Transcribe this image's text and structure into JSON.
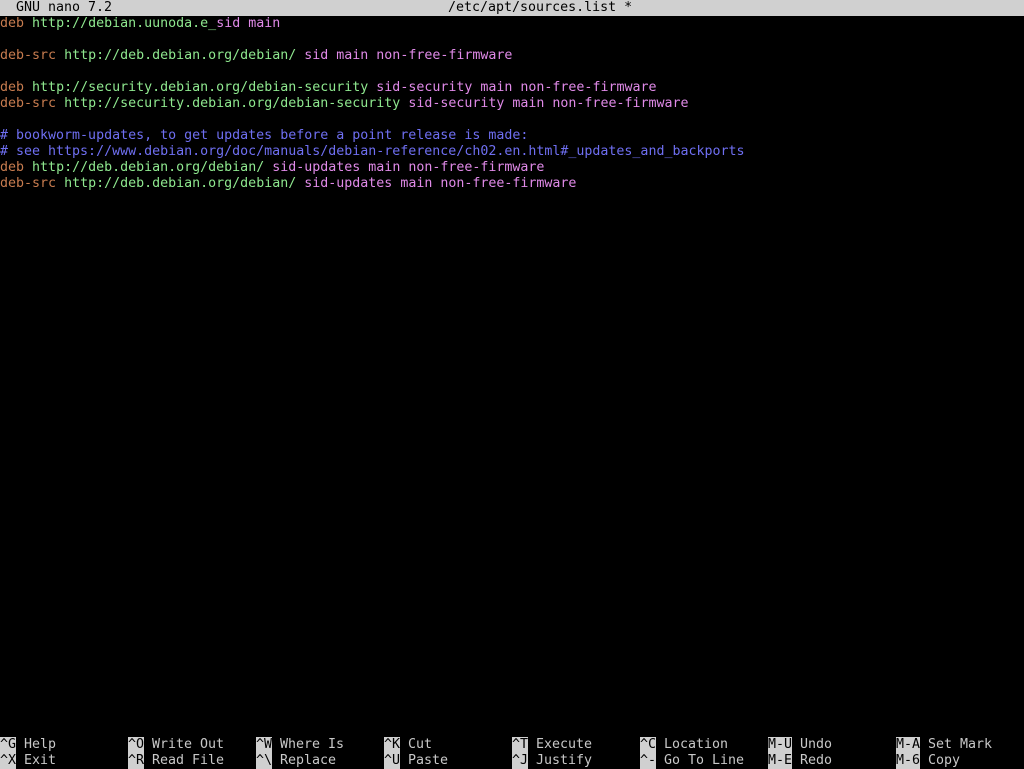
{
  "titlebar": {
    "app": "GNU nano 7.2",
    "file": "/etc/apt/sources.list *"
  },
  "colors": {
    "type": "#c77c4f",
    "url": "#8fe88f",
    "component": "#e08ae8",
    "comment": "#6f6ff2",
    "titlebar_bg": "#d0d0d0"
  },
  "editor": {
    "lines": [
      {
        "kind": "entry",
        "type": "deb",
        "url": "http://debian.uunoda.e",
        "cursor": "_",
        "rest": "sid main"
      },
      {
        "kind": "blank"
      },
      {
        "kind": "entry",
        "type": "deb-src",
        "url": "http://deb.debian.org/debian/",
        "rest": "sid main non-free-firmware"
      },
      {
        "kind": "blank"
      },
      {
        "kind": "entry",
        "type": "deb",
        "url": "http://security.debian.org/debian-security",
        "rest": "sid-security main non-free-firmware"
      },
      {
        "kind": "entry",
        "type": "deb-src",
        "url": "http://security.debian.org/debian-security",
        "rest": "sid-security main non-free-firmware"
      },
      {
        "kind": "blank"
      },
      {
        "kind": "comment",
        "text": "# bookworm-updates, to get updates before a point release is made:"
      },
      {
        "kind": "comment",
        "text": "# see https://www.debian.org/doc/manuals/debian-reference/ch02.en.html#_updates_and_backports"
      },
      {
        "kind": "entry",
        "type": "deb",
        "url": "http://deb.debian.org/debian/",
        "rest": "sid-updates main non-free-firmware"
      },
      {
        "kind": "entry",
        "type": "deb-src",
        "url": "http://deb.debian.org/debian/",
        "rest": "sid-updates main non-free-firmware"
      }
    ]
  },
  "shortcuts": {
    "row1": [
      {
        "key": "^G",
        "label": "Help"
      },
      {
        "key": "^O",
        "label": "Write Out"
      },
      {
        "key": "^W",
        "label": "Where Is"
      },
      {
        "key": "^K",
        "label": "Cut"
      },
      {
        "key": "^T",
        "label": "Execute"
      },
      {
        "key": "^C",
        "label": "Location"
      },
      {
        "key": "M-U",
        "label": "Undo"
      },
      {
        "key": "M-A",
        "label": "Set Mark"
      }
    ],
    "row2": [
      {
        "key": "^X",
        "label": "Exit"
      },
      {
        "key": "^R",
        "label": "Read File"
      },
      {
        "key": "^\\",
        "label": "Replace"
      },
      {
        "key": "^U",
        "label": "Paste"
      },
      {
        "key": "^J",
        "label": "Justify"
      },
      {
        "key": "^-",
        "label": "Go To Line"
      },
      {
        "key": "M-E",
        "label": "Redo"
      },
      {
        "key": "M-6",
        "label": "Copy"
      }
    ]
  }
}
